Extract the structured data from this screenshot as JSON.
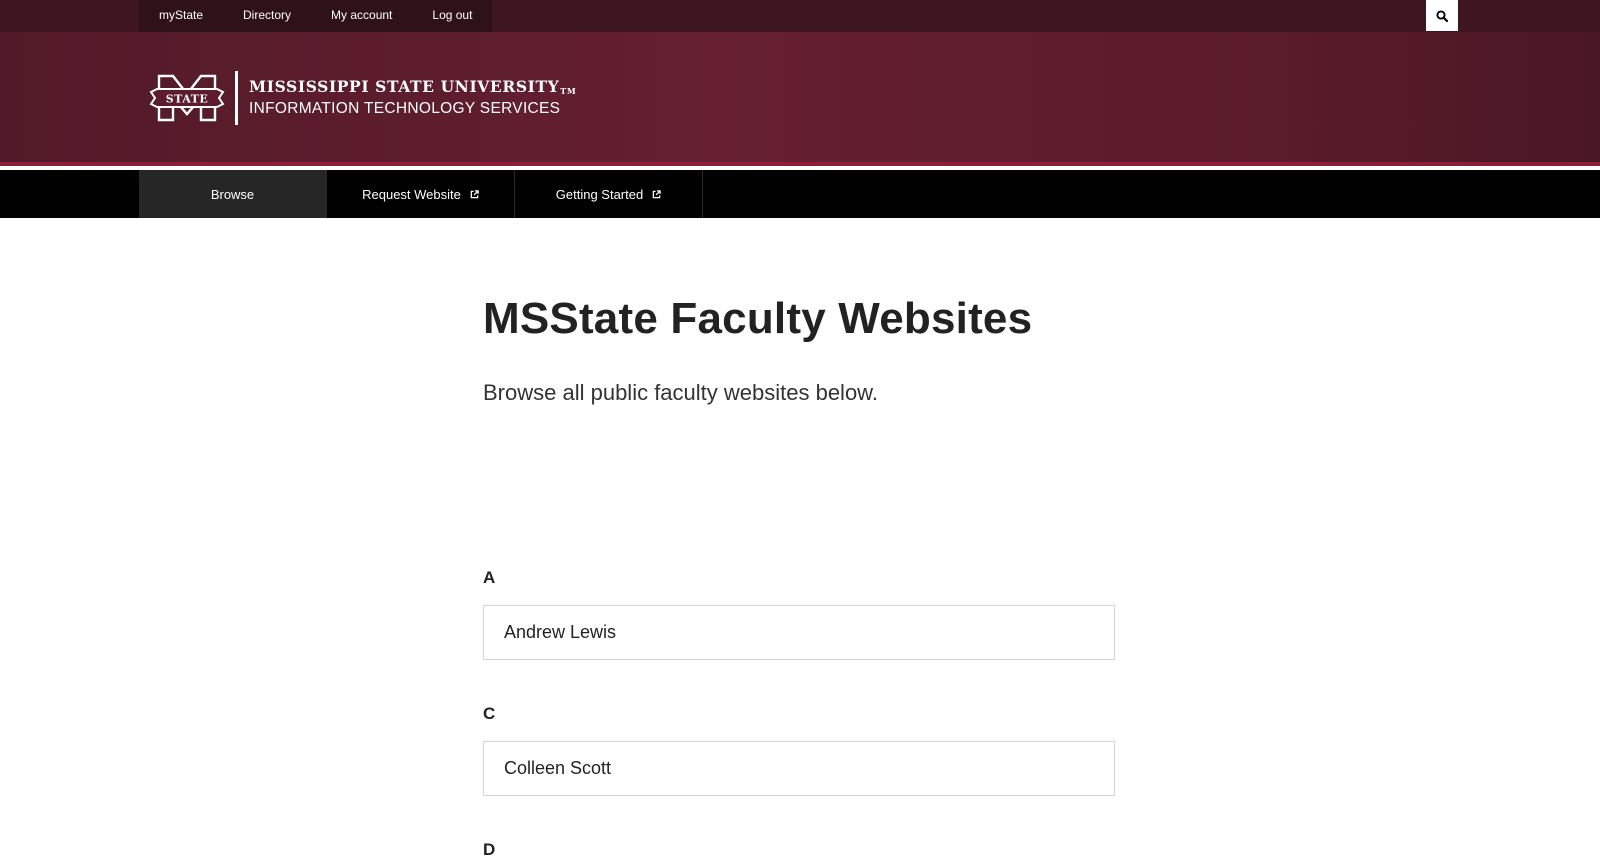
{
  "utility_nav": {
    "items": [
      {
        "label": "myState"
      },
      {
        "label": "Directory"
      },
      {
        "label": "My account"
      },
      {
        "label": "Log out"
      }
    ],
    "search_icon": "search-icon"
  },
  "header": {
    "logo_mark_text": "STATE",
    "university": "MISSISSIPPI STATE UNIVERSITY",
    "trademark": "TM",
    "department": "INFORMATION TECHNOLOGY SERVICES"
  },
  "main_nav": {
    "items": [
      {
        "label": "Browse",
        "active": true
      },
      {
        "label": "Request Website",
        "icon": "external-link-icon"
      },
      {
        "label": "Getting Started",
        "icon": "external-link-icon"
      }
    ]
  },
  "content": {
    "title": "MSState Faculty Websites",
    "lead": "Browse all public faculty websites below.",
    "groups": [
      {
        "letter": "A",
        "entries": [
          "Andrew Lewis"
        ]
      },
      {
        "letter": "C",
        "entries": [
          "Colleen Scott"
        ]
      },
      {
        "letter": "D",
        "entries": []
      }
    ]
  },
  "colors": {
    "utility_bar": "#3d161f",
    "header_maroon": "#5d1c2b",
    "header_accent": "#8a1f35",
    "nav_bg": "#000000",
    "nav_active": "#262626"
  }
}
